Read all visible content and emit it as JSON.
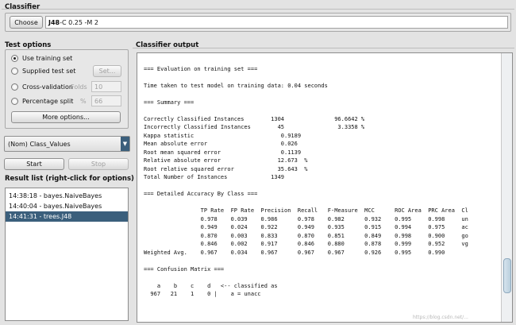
{
  "classifier": {
    "section_title": "Classifier",
    "choose_label": "Choose",
    "name": "J48",
    "options": " -C 0.25 -M 2"
  },
  "test_options": {
    "section_title": "Test options",
    "use_training_set": "Use training set",
    "supplied_test_set": "Supplied test set",
    "set_button": "Set...",
    "cross_validation": "Cross-validation",
    "folds_label": "Folds",
    "folds_value": "10",
    "percentage_split": "Percentage split",
    "percent_label": "%",
    "percent_value": "66",
    "more_options": "More options..."
  },
  "class_select": {
    "value": "(Nom) Class_Values"
  },
  "run": {
    "start_label": "Start",
    "stop_label": "Stop"
  },
  "result_list": {
    "section_title": "Result list (right-click for options)",
    "items": [
      {
        "label": "14:38:18 - bayes.NaiveBayes"
      },
      {
        "label": "14:40:04 - bayes.NaiveBayes"
      },
      {
        "label": "14:41:31 - trees.J48"
      }
    ]
  },
  "output": {
    "section_title": "Classifier output",
    "text": "\n=== Evaluation on training set ===\n\nTime taken to test model on training data: 0.04 seconds\n\n=== Summary ===\n\nCorrectly Classified Instances        1304               96.6642 %\nIncorrectly Classified Instances        45                3.3358 %\nKappa statistic                          0.9189\nMean absolute error                      0.026\nRoot mean squared error                  0.1139\nRelative absolute error                 12.673  %\nRoot relative squared error             35.643  %\nTotal Number of Instances             1349\n\n=== Detailed Accuracy By Class ===\n\n                 TP Rate  FP Rate  Precision  Recall   F-Measure  MCC      ROC Area  PRC Area  Cl\n                 0.978    0.039    0.986      0.978    0.982      0.932    0.995     0.998     un\n                 0.949    0.024    0.922      0.949    0.935      0.915    0.994     0.975     ac\n                 0.870    0.003    0.833      0.870    0.851      0.849    0.998     0.900     go\n                 0.846    0.002    0.917      0.846    0.880      0.878    0.999     0.952     vg\nWeighted Avg.    0.967    0.034    0.967      0.967    0.967      0.926    0.995     0.990\n\n=== Confusion Matrix ===\n\n    a    b    c    d   <-- classified as\n  967   21    1    0 |    a = unacc"
  },
  "watermark": "https://blog.csdn.net/...",
  "colors": {
    "selected": "#3b5f7c",
    "background": "#e3e3e3"
  }
}
